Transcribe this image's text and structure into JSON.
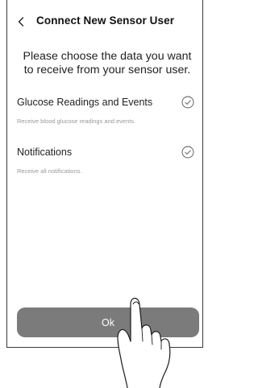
{
  "header": {
    "title": "Connect New Sensor User",
    "back_icon": "chevron-left-icon"
  },
  "intro": "Please choose the data you want to receive from your sensor user.",
  "options": [
    {
      "title": "Glucose Readings and Events",
      "subtitle": "Receive blood glucose readings and events.",
      "icon": "check-circle-icon"
    },
    {
      "title": "Notifications",
      "subtitle": "Receive all notifications.",
      "icon": "check-circle-icon"
    }
  ],
  "ok_button": {
    "label": "Ok",
    "color": "#7b7b7b"
  },
  "overlay": {
    "icon": "pointing-hand-icon"
  }
}
